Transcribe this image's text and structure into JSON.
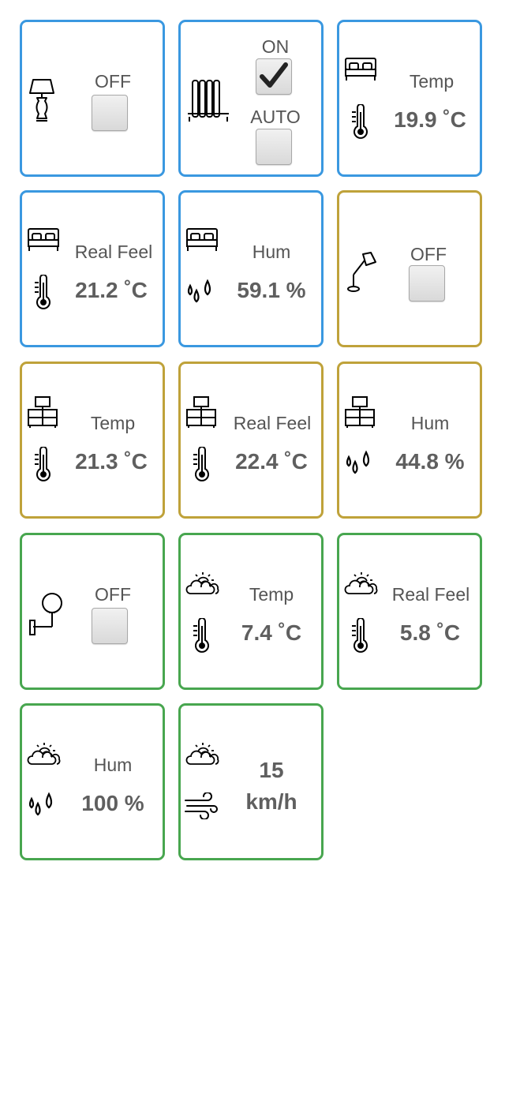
{
  "colors": {
    "bedroom": "#3a98e0",
    "office": "#bfa23a",
    "outdoor": "#48a64f"
  },
  "bedroom": {
    "lamp": {
      "icon": "table-lamp-icon",
      "state": "OFF",
      "checked": false
    },
    "heater": {
      "icon": "radiator-icon",
      "on_label": "ON",
      "on_checked": true,
      "auto_label": "AUTO",
      "auto_checked": false
    },
    "temp": {
      "icon": "bed-icon",
      "label": "Temp",
      "value": "19.9 ˚C"
    },
    "real_feel": {
      "icon": "bed-icon",
      "label": "Real Feel",
      "value": "21.2 ˚C"
    },
    "hum": {
      "icon": "bed-icon",
      "label": "Hum",
      "value": "59.1 %"
    }
  },
  "office": {
    "lamp": {
      "icon": "desk-lamp-icon",
      "state": "OFF",
      "checked": false
    },
    "temp": {
      "icon": "dresser-icon",
      "label": "Temp",
      "value": "21.3 ˚C"
    },
    "real_feel": {
      "icon": "dresser-icon",
      "label": "Real Feel",
      "value": "22.4 ˚C"
    },
    "hum": {
      "icon": "dresser-icon",
      "label": "Hum",
      "value": "44.8 %"
    }
  },
  "outdoor": {
    "lamp": {
      "icon": "wall-lamp-icon",
      "state": "OFF",
      "checked": false
    },
    "temp": {
      "icon": "partly-cloudy-icon",
      "label": "Temp",
      "value": "7.4 ˚C"
    },
    "real_feel": {
      "icon": "partly-cloudy-icon",
      "label": "Real Feel",
      "value": "5.8 ˚C"
    },
    "hum": {
      "icon": "partly-cloudy-icon",
      "label": "Hum",
      "value": "100 %"
    },
    "wind": {
      "icon": "partly-cloudy-icon",
      "value": "15",
      "unit": "km/h"
    }
  }
}
